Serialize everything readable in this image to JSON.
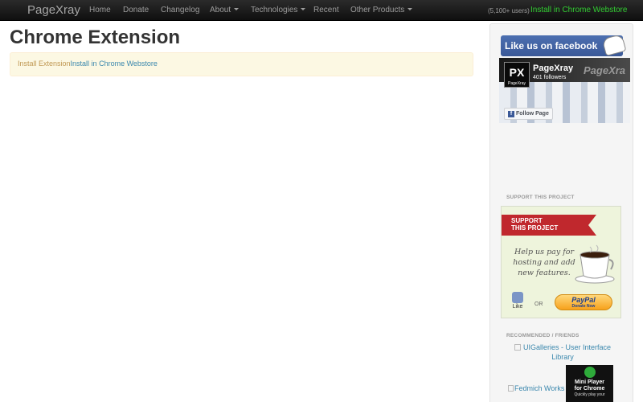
{
  "navbar": {
    "brand": "PageXray",
    "items": [
      {
        "label": "Home",
        "dropdown": false
      },
      {
        "label": "Donate",
        "dropdown": false
      },
      {
        "label": "Changelog",
        "dropdown": false
      },
      {
        "label": "About",
        "dropdown": true
      },
      {
        "label": "Technologies",
        "dropdown": true
      },
      {
        "label": "Recent",
        "dropdown": false
      },
      {
        "label": "Other Products",
        "dropdown": true
      }
    ],
    "users_count": "(5,100+ users)",
    "install_link": "Install in Chrome Webstore"
  },
  "main": {
    "title": "Chrome Extension",
    "alert_text": "Install Extension",
    "alert_link": "Install in Chrome Webstore"
  },
  "sidebar": {
    "fb_like_banner": "Like us on facebook",
    "fb_page": {
      "logo": "PX",
      "logo_sub": "PageXray",
      "name": "PageXray",
      "followers": "401 followers",
      "watermark": "PageXra",
      "follow_button": "Follow Page"
    },
    "support_heading": "SUPPORT THIS PROJECT",
    "support_ribbon_line1": "SUPPORT",
    "support_ribbon_line2": "THIS PROJECT",
    "support_text": "Help us pay for hosting and add new features.",
    "like_label": "Like",
    "or_label": "OR",
    "paypal_label": "PayPal",
    "paypal_sub": "Donate Now",
    "recommended_heading": "RECOMMENDED / FRIENDS",
    "uigalleries_link": "UIGalleries - User Interface Library",
    "fedmich_link": "Fedmich Works",
    "mini_player_line1": "Mini Player",
    "mini_player_line2": "for Chrome",
    "mini_player_sub": "Quickly play your"
  },
  "colors": {
    "navbar_bg": "#1b1b1b",
    "install_green": "#32cd32",
    "alert_bg": "#fcf8e3",
    "alert_text": "#c09853",
    "link_blue": "#3a87ad",
    "facebook_blue": "#3b5998"
  }
}
